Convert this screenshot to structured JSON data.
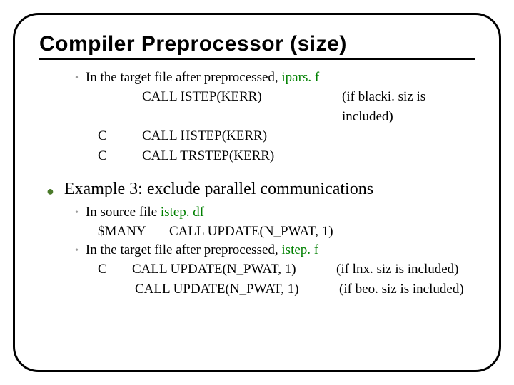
{
  "title": "Compiler Preprocessor (size)",
  "section1": {
    "intro_pre": "In the target file after preprocessed, ",
    "intro_file": "ipars. f",
    "rows": [
      {
        "c": "",
        "call": "CALL ISTEP(KERR)",
        "note": "(if blacki. siz is included)"
      },
      {
        "c": "C",
        "call": "CALL HSTEP(KERR)",
        "note": ""
      },
      {
        "c": "C",
        "call": "CALL TRSTEP(KERR)",
        "note": ""
      }
    ]
  },
  "example3": {
    "heading": "Example 3: exclude parallel communications",
    "b1_pre": "In source file ",
    "b1_file": "istep. df",
    "many": "$MANY",
    "many_call": "CALL UPDATE(N_PWAT, 1)",
    "b2_pre": "In the target file after preprocessed, ",
    "b2_file": "istep. f",
    "rows": [
      {
        "c": "C",
        "call": "CALL UPDATE(N_PWAT, 1)",
        "note": "(if lnx. siz is included)"
      },
      {
        "c": "",
        "call": "CALL UPDATE(N_PWAT, 1)",
        "note": "(if beo. siz is included)"
      }
    ]
  }
}
